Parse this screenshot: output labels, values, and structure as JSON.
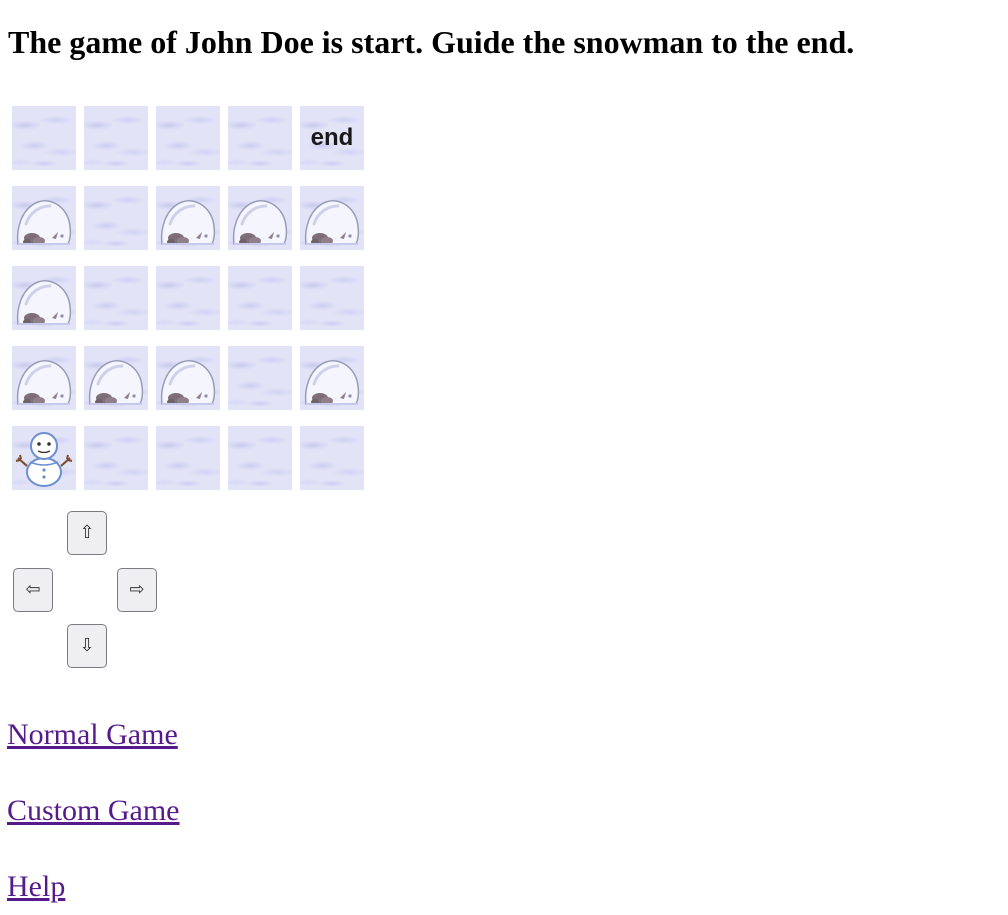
{
  "page": {
    "title": "The game of John Doe is start. Guide the snowman to the end."
  },
  "board": {
    "end_label": "end",
    "grid": [
      [
        "snow",
        "snow",
        "snow",
        "snow",
        "end"
      ],
      [
        "rock",
        "snow",
        "rock",
        "rock",
        "rock"
      ],
      [
        "rock",
        "snow",
        "snow",
        "snow",
        "snow"
      ],
      [
        "rock",
        "rock",
        "rock",
        "snow",
        "rock"
      ],
      [
        "snowman",
        "snow",
        "snow",
        "snow",
        "snow"
      ]
    ],
    "tile_icons": {
      "snow": "snow-tile-icon",
      "rock": "snow-rock-icon",
      "snowman": "snowman-icon",
      "end": "end-tile"
    }
  },
  "controls": {
    "up": "⇧",
    "left": "⇦",
    "right": "⇨",
    "down": "⇩"
  },
  "links": {
    "normal_game": "Normal Game",
    "custom_game": "Custom Game",
    "help": "Help"
  },
  "colors": {
    "link": "#551a8b",
    "tile_base": "#e2e3f7"
  }
}
